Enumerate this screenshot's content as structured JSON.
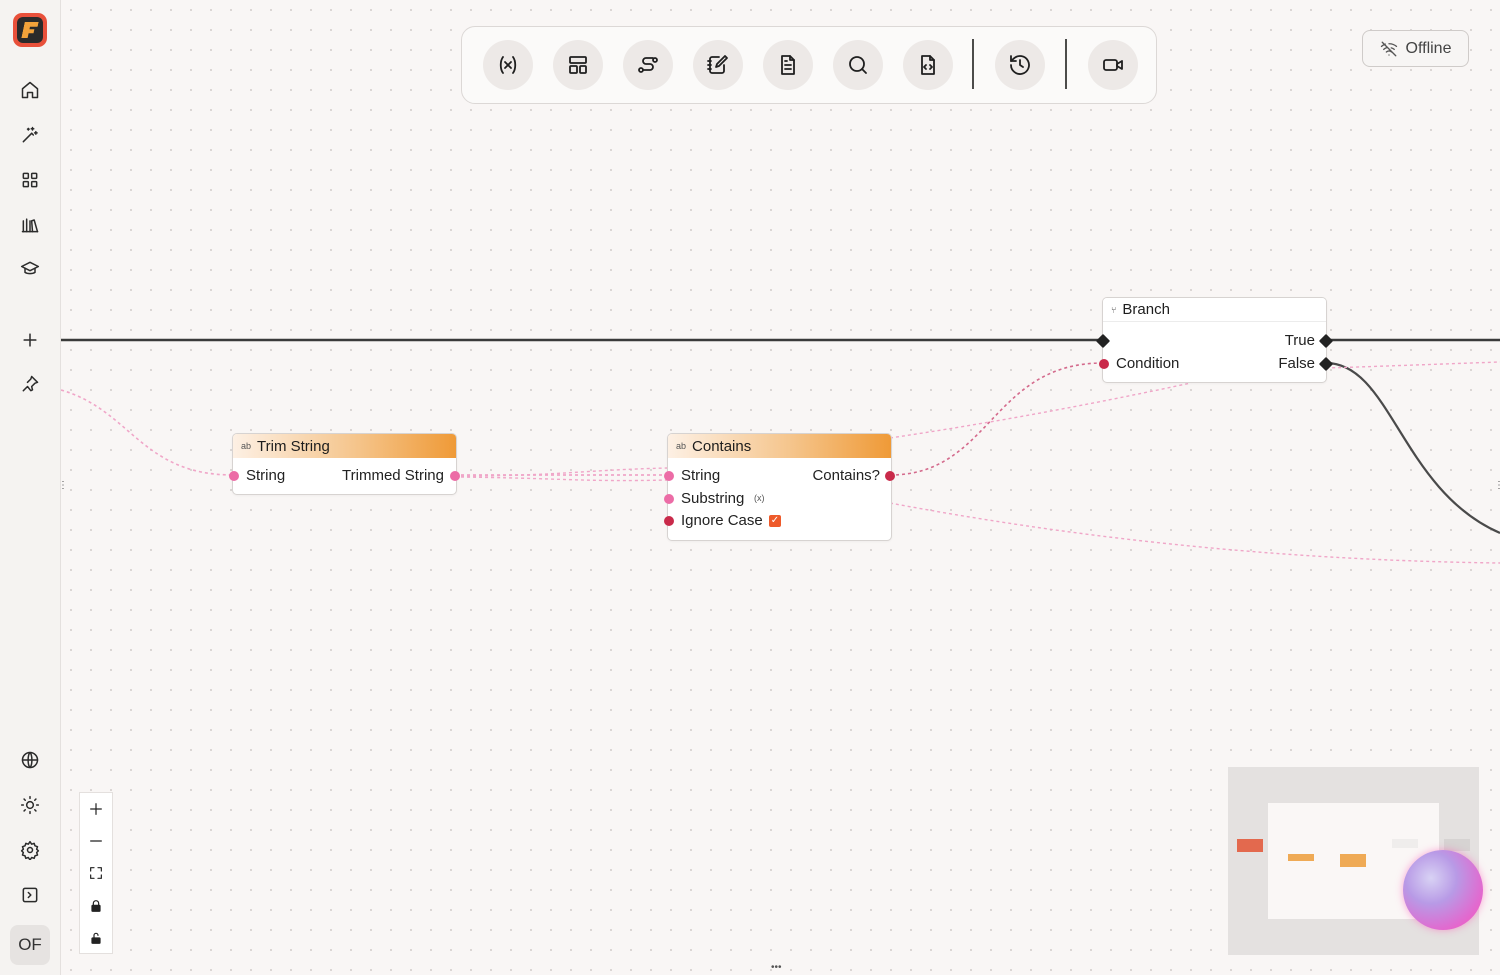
{
  "sidebar": {
    "top_items": [
      {
        "name": "home",
        "icon": "home-icon"
      },
      {
        "name": "ai-sparkles",
        "icon": "sparkles-wand-icon"
      },
      {
        "name": "apps",
        "icon": "grid-icon"
      },
      {
        "name": "library",
        "icon": "library-icon"
      },
      {
        "name": "learn",
        "icon": "graduation-cap-icon"
      },
      {
        "name": "add",
        "icon": "plus-icon"
      },
      {
        "name": "pin",
        "icon": "pin-icon"
      }
    ],
    "bottom_items": [
      {
        "name": "language",
        "icon": "globe-icon"
      },
      {
        "name": "theme",
        "icon": "sun-icon"
      },
      {
        "name": "settings",
        "icon": "gear-icon"
      },
      {
        "name": "toggle-panel",
        "icon": "panel-toggle-icon"
      }
    ],
    "avatar_initials": "OF"
  },
  "toolbar": {
    "buttons": [
      {
        "name": "variables",
        "icon": "variable-icon"
      },
      {
        "name": "layout",
        "icon": "layout-icon"
      },
      {
        "name": "workflow",
        "icon": "route-icon"
      },
      {
        "name": "edit-notes",
        "icon": "notebook-pen-icon"
      },
      {
        "name": "document",
        "icon": "document-icon"
      },
      {
        "name": "search",
        "icon": "search-icon"
      },
      {
        "name": "code-file",
        "icon": "file-code-icon"
      },
      {
        "name": "history",
        "icon": "history-icon"
      },
      {
        "name": "record",
        "icon": "video-icon"
      }
    ]
  },
  "status": {
    "offline_label": "Offline",
    "icon": "wifi-off-icon"
  },
  "nodes": {
    "trim_string": {
      "title": "Trim String",
      "icon": "string-type-icon",
      "input": "String",
      "output": "Trimmed String"
    },
    "contains": {
      "title": "Contains",
      "icon": "string-type-icon",
      "inputs": [
        "String",
        "Substring",
        "Ignore Case"
      ],
      "output": "Contains?",
      "ignore_case_checked": true
    },
    "branch": {
      "title": "Branch",
      "icon": "branch-icon",
      "input": "Condition",
      "outputs": [
        "True",
        "False"
      ]
    }
  },
  "zoom_controls": [
    {
      "name": "zoom-in",
      "icon": "plus-icon"
    },
    {
      "name": "zoom-out",
      "icon": "minus-icon"
    },
    {
      "name": "fit-view",
      "icon": "fullscreen-icon"
    },
    {
      "name": "lock",
      "icon": "lock-icon"
    },
    {
      "name": "unlock",
      "icon": "unlock-icon"
    }
  ],
  "colors": {
    "accent_orange": "#ef9a37",
    "pin_pink": "#ec6ca6",
    "pin_red": "#c92a4a",
    "wire_pink": "#f0a6c8",
    "exec_wire": "#3a3a3a"
  }
}
